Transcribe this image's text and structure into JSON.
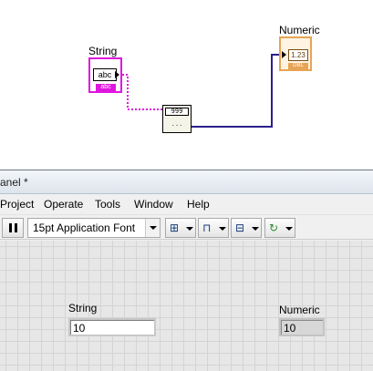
{
  "diagram": {
    "string_label": "String",
    "string_inner": "abc",
    "string_type": "abc",
    "numeric_label": "Numeric",
    "numeric_inner": "1.23",
    "numeric_type": "DBL",
    "convert_top": "999",
    "convert_bottom": "···",
    "wire_color_string": "#e016e0",
    "wire_color_numeric": "#2b1f8c"
  },
  "window": {
    "title": "anel *"
  },
  "menu": {
    "items": [
      "Project",
      "Operate",
      "Tools",
      "Window",
      "Help"
    ]
  },
  "toolbar": {
    "pause_icon": "pause-icon",
    "font_select_value": "15pt Application Font",
    "align_icon": "align-objects-icon",
    "distribute_icon": "distribute-objects-icon",
    "resize_icon": "resize-objects-icon",
    "reorder_icon": "reorder-icon"
  },
  "front_panel": {
    "string_label": "String",
    "string_value": "10",
    "numeric_label": "Numeric",
    "numeric_value": "10"
  }
}
